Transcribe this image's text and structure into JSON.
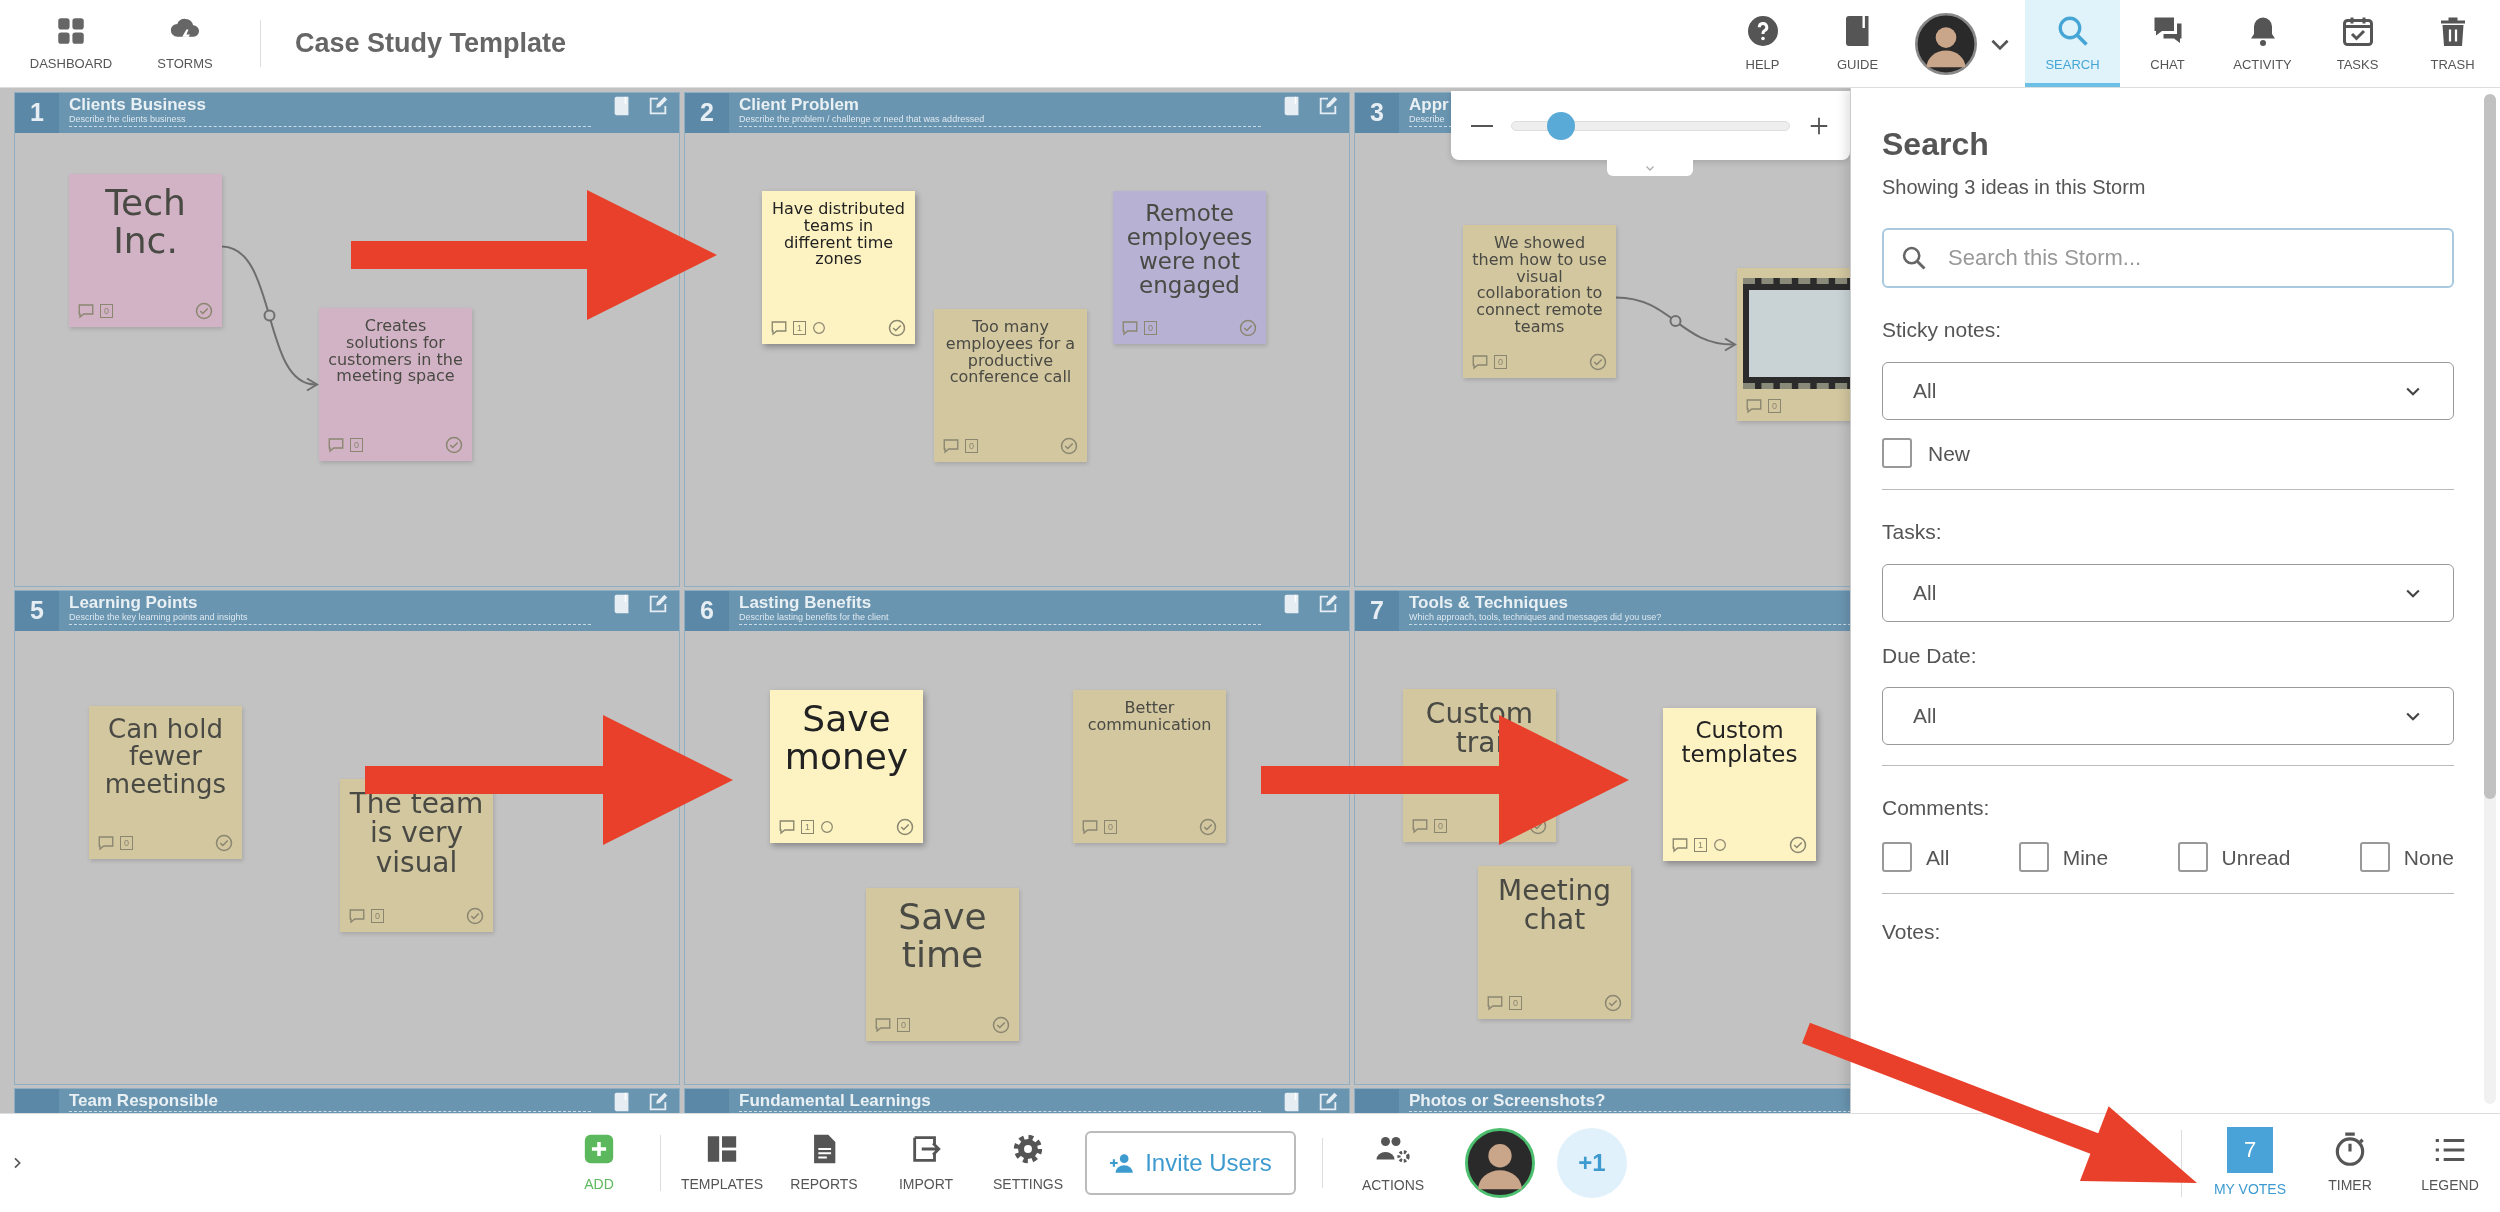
{
  "header": {
    "nav": [
      {
        "label": "DASHBOARD"
      },
      {
        "label": "STORMS"
      }
    ],
    "title": "Case Study Template",
    "tools": [
      {
        "label": "HELP",
        "selected": false
      },
      {
        "label": "GUIDE",
        "selected": false
      },
      {
        "label": "SEARCH",
        "selected": true
      },
      {
        "label": "CHAT",
        "selected": false
      },
      {
        "label": "ACTIVITY",
        "selected": false
      },
      {
        "label": "TASKS",
        "selected": false
      },
      {
        "label": "TRASH",
        "selected": false
      }
    ]
  },
  "panels": [
    {
      "number": "1",
      "title": "Clients Business",
      "subtitle": "Describe the clients business"
    },
    {
      "number": "2",
      "title": "Client Problem",
      "subtitle": "Describe the problem / challenge or need that was addressed"
    },
    {
      "number": "3",
      "title": "Appr",
      "subtitle": "Describe"
    },
    {
      "number": "5",
      "title": "Learning Points",
      "subtitle": "Describe the key learning points and insights"
    },
    {
      "number": "6",
      "title": "Lasting Benefits",
      "subtitle": "Describe lasting benefits for the client"
    },
    {
      "number": "7",
      "title": "Tools & Techniques",
      "subtitle": "Which approach, tools, techniques and messages did you use?"
    },
    {
      "title": "Team Responsible"
    },
    {
      "title": "Fundamental Learnings"
    },
    {
      "title": "Photos or Screenshots?"
    }
  ],
  "notes": [
    {
      "kind": "text",
      "text": "Tech Inc.",
      "color": "#d2b3c5",
      "highlighted": false,
      "votes": "0"
    },
    {
      "kind": "text",
      "text": "Creates solutions for customers in the meeting space",
      "color": "#d2b3c5",
      "highlighted": false,
      "votes": "0"
    },
    {
      "kind": "text",
      "text": "Have distributed teams in different time zones",
      "color": "#fdf3c2",
      "highlighted": true,
      "votes": "1"
    },
    {
      "kind": "text",
      "text": "Too many employees for a productive conference call",
      "color": "#d3c7a0",
      "highlighted": false,
      "votes": "0"
    },
    {
      "kind": "text",
      "text": "Remote employees were not engaged",
      "color": "#b7b1d3",
      "highlighted": false,
      "votes": "0"
    },
    {
      "kind": "text",
      "text": "We showed them how to use visual collaboration to connect remote teams",
      "color": "#d3c7a0",
      "highlighted": false,
      "votes": "0"
    },
    {
      "kind": "video",
      "color": "#d3c7a0",
      "highlighted": false,
      "votes": "0"
    },
    {
      "kind": "text",
      "text": "Can hold fewer meetings",
      "color": "#d3c7a0",
      "highlighted": false,
      "votes": "0"
    },
    {
      "kind": "text",
      "text": "The team is very visual",
      "color": "#d3c7a0",
      "highlighted": false,
      "votes": "0"
    },
    {
      "kind": "text",
      "text": "Save money",
      "color": "#fdf3c2",
      "highlighted": true,
      "votes": "1"
    },
    {
      "kind": "text",
      "text": "Better communication",
      "color": "#d3c7a0",
      "highlighted": false,
      "votes": "0"
    },
    {
      "kind": "text",
      "text": "Save time",
      "color": "#d3c7a0",
      "highlighted": false,
      "votes": "0"
    },
    {
      "kind": "text",
      "text": "Custom trai",
      "color": "#d3c7a0",
      "highlighted": false,
      "votes": "0"
    },
    {
      "kind": "text",
      "text": "Custom templates",
      "color": "#fdf3c2",
      "highlighted": true,
      "votes": "1"
    },
    {
      "kind": "text",
      "text": "Meeting chat",
      "color": "#d3c7a0",
      "highlighted": false,
      "votes": "0"
    }
  ],
  "connectors": [
    {
      "kind": "curved"
    },
    {
      "kind": "curved"
    }
  ],
  "callout_arrows": [
    {
      "kind": "horizontal"
    },
    {
      "kind": "horizontal"
    },
    {
      "kind": "horizontal"
    },
    {
      "kind": "diagonal"
    }
  ],
  "zoom": {
    "level": 0.18
  },
  "search": {
    "title": "Search",
    "summary": "Showing 3 ideas in this Storm",
    "placeholder": "Search this Storm...",
    "groups": [
      [
        {
          "kind": "select",
          "label": "Sticky notes:",
          "value": "All"
        },
        {
          "kind": "checkbox",
          "label": "New",
          "checked": false
        }
      ],
      [
        {
          "kind": "select",
          "label": "Tasks:",
          "value": "All"
        },
        {
          "kind": "select",
          "label": "Due Date:",
          "value": "All"
        }
      ],
      [
        {
          "kind": "checkgroup",
          "label": "Comments:",
          "options": [
            {
              "label": "All",
              "checked": false
            },
            {
              "label": "Mine",
              "checked": false
            },
            {
              "label": "Unread",
              "checked": false
            },
            {
              "label": "None",
              "checked": false
            }
          ]
        }
      ],
      [
        {
          "kind": "heading",
          "label": "Votes:"
        }
      ]
    ]
  },
  "footer": {
    "tools": [
      {
        "kind": "add",
        "label": "ADD"
      },
      {
        "kind": "tool",
        "label": "TEMPLATES"
      },
      {
        "kind": "tool",
        "label": "REPORTS"
      },
      {
        "kind": "tool",
        "label": "IMPORT"
      },
      {
        "kind": "tool",
        "label": "SETTINGS"
      }
    ],
    "invite": "Invite Users",
    "actions": "ACTIONS",
    "more_users": "+1",
    "right": [
      {
        "label": "MY VOTES",
        "badge": "7",
        "selected": true
      },
      {
        "label": "TIMER",
        "selected": false
      },
      {
        "label": "LEGEND",
        "selected": false
      }
    ]
  }
}
